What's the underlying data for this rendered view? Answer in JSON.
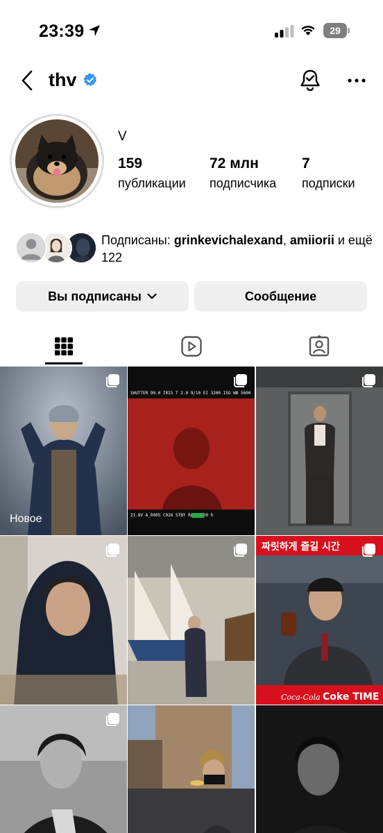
{
  "status_bar": {
    "time": "23:39",
    "battery_level": "29",
    "icons": [
      "location-arrow-icon",
      "cellular-signal-icon",
      "wifi-icon",
      "battery-icon"
    ]
  },
  "header": {
    "username": "thv",
    "verified": true,
    "icons": [
      "back-chevron-icon",
      "verified-badge-icon",
      "notification-bell-icon",
      "more-dots-icon"
    ]
  },
  "profile": {
    "display_name": "V",
    "stats": [
      {
        "value": "159",
        "label": "публикации"
      },
      {
        "value": "72 млн",
        "label": "подписчика"
      },
      {
        "value": "7",
        "label": "подписки"
      }
    ]
  },
  "followed_by": {
    "prefix": "Подписаны: ",
    "user1": "grinkevichalexand",
    "separator": ", ",
    "user2": "amiiorii",
    "suffix": " и ещё 122"
  },
  "actions": {
    "follow_label": "Вы подписаны",
    "message_label": "Сообщение"
  },
  "tabs": [
    {
      "name": "posts-grid",
      "icon": "grid-icon",
      "active": true
    },
    {
      "name": "reels",
      "icon": "reels-play-icon",
      "active": false
    },
    {
      "name": "tagged",
      "icon": "tagged-person-icon",
      "active": false
    }
  ],
  "grid": {
    "new_label": "Новое",
    "cell1_overlay": {
      "camera_hud_top": [
        "SHUTTER 90.0",
        "IRIS T 2.0",
        "9/10",
        "EI 3200",
        "ISO",
        "WB 5600"
      ],
      "camera_hud_bottom": [
        "21.8V",
        "A_0005",
        "C026",
        "STBY",
        "Rec",
        "1:20 h"
      ]
    },
    "cell5_overlay": {
      "banner_text": "짜릿하게 즐길 시간",
      "brand": "Coca-Cola",
      "campaign": "Coke TIME"
    },
    "colors": {
      "accent_red": "#d8101d",
      "verified_blue": "#3797f0"
    }
  }
}
